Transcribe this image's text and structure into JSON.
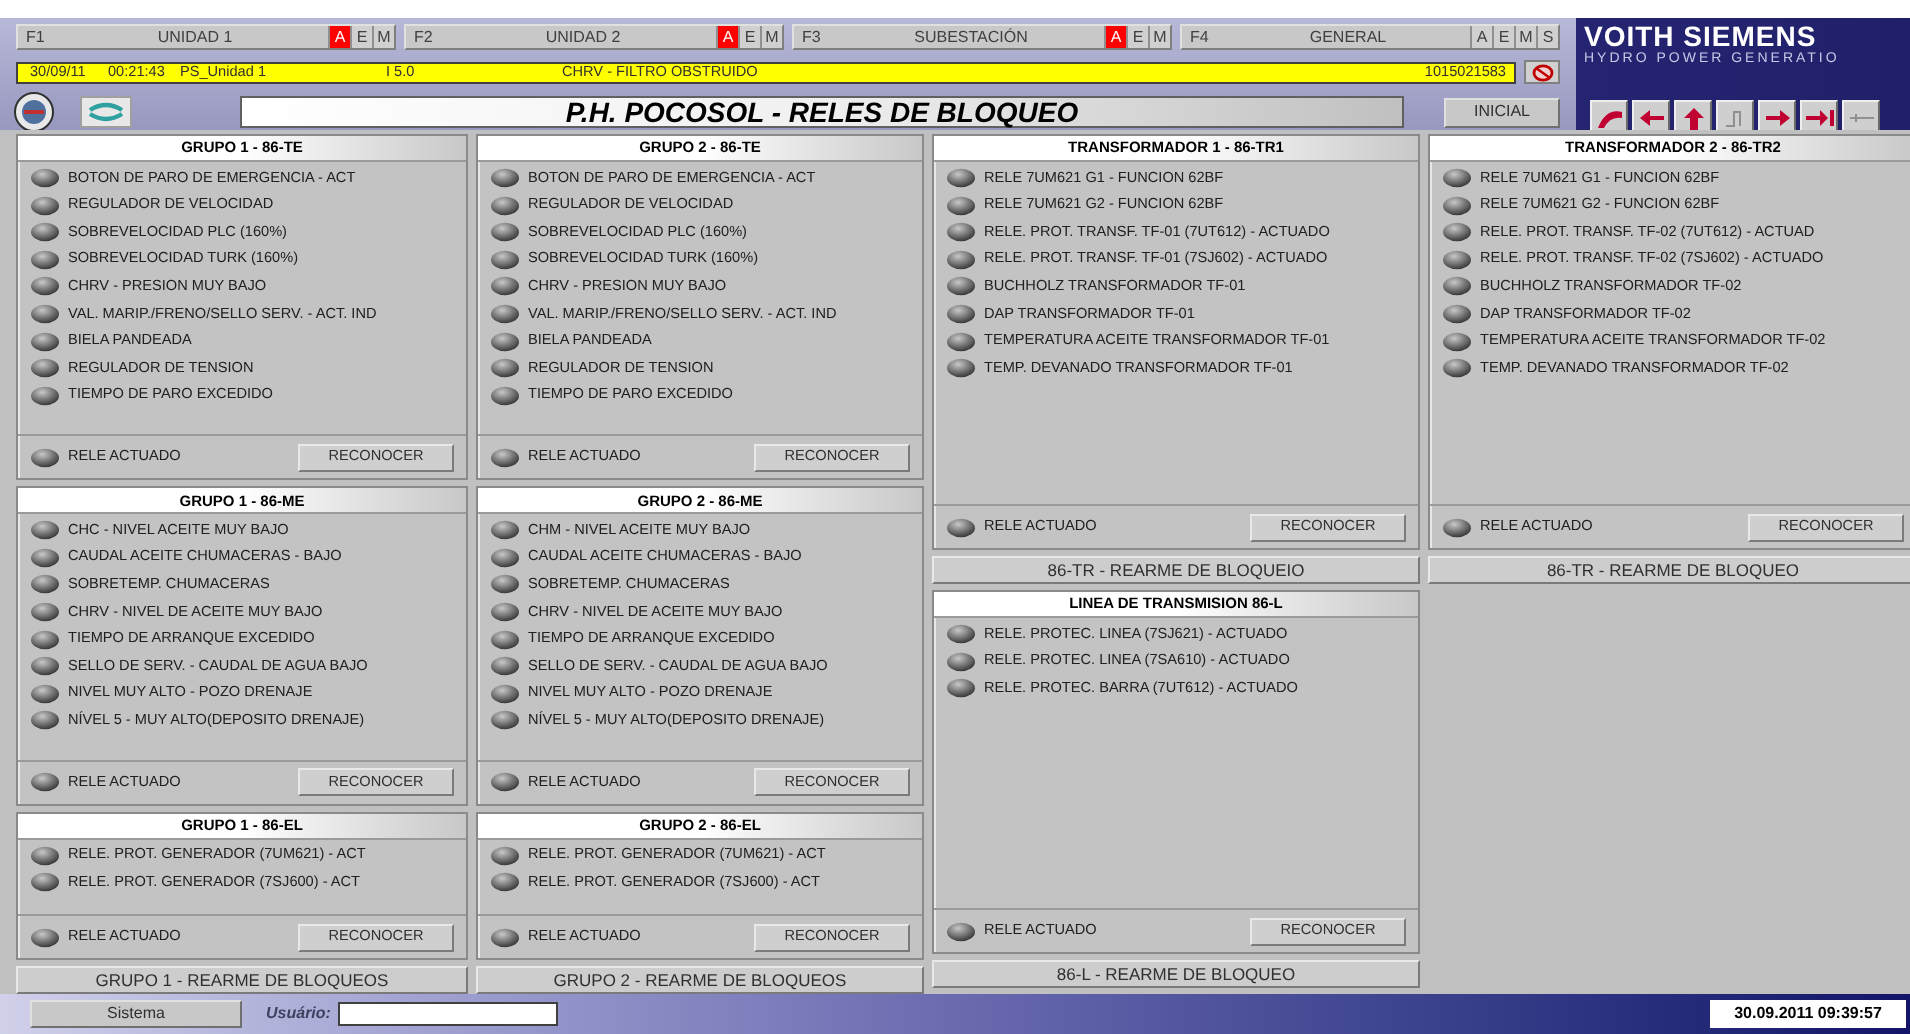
{
  "tabs": [
    {
      "key": "F1",
      "label": "UNIDAD 1",
      "flags": [
        {
          "letter": "A",
          "active": true
        },
        {
          "letter": "E",
          "active": false
        },
        {
          "letter": "M",
          "active": false
        }
      ]
    },
    {
      "key": "F2",
      "label": "UNIDAD 2",
      "flags": [
        {
          "letter": "A",
          "active": true
        },
        {
          "letter": "E",
          "active": false
        },
        {
          "letter": "M",
          "active": false
        }
      ]
    },
    {
      "key": "F3",
      "label": "SUBESTACIÓN",
      "flags": [
        {
          "letter": "A",
          "active": true
        },
        {
          "letter": "E",
          "active": false
        },
        {
          "letter": "M",
          "active": false
        }
      ]
    },
    {
      "key": "F4",
      "label": "GENERAL",
      "flags": [
        {
          "letter": "A",
          "active": false
        },
        {
          "letter": "E",
          "active": false
        },
        {
          "letter": "M",
          "active": false
        },
        {
          "letter": "S",
          "active": false
        }
      ]
    }
  ],
  "brand": {
    "name": "VOITH SIEMENS",
    "tagline": "HYDRO POWER GENERATIO"
  },
  "alarm_bar": {
    "date": "30/09/11",
    "time": "00:21:43",
    "source": "PS_Unidad 1",
    "code": "I 5.0",
    "message": "CHRV - FILTRO OBSTRUIDO",
    "counter": "1015021583"
  },
  "title": "P.H. POCOSOL - RELES DE BLOQUEO",
  "home_button": "INICIAL",
  "columns": [
    [
      {
        "kind": "panel",
        "title": "GRUPO 1 - 86-TE",
        "items": [
          {
            "label": "BOTON DE PARO DE EMERGENCIA - ACT",
            "active": false
          },
          {
            "label": "REGULADOR DE VELOCIDAD",
            "active": false
          },
          {
            "label": "SOBREVELOCIDAD  PLC (160%)",
            "active": false
          },
          {
            "label": "SOBREVELOCIDAD  TURK (160%)",
            "active": false
          },
          {
            "label": "CHRV -  PRESION MUY BAJO",
            "active": false
          },
          {
            "label": "VAL. MARIP./FRENO/SELLO SERV. - ACT. IND",
            "active": false
          },
          {
            "label": "BIELA PANDEADA",
            "active": false
          },
          {
            "label": "REGULADOR DE TENSION",
            "active": false
          },
          {
            "label": "TIEMPO DE PARO EXCEDIDO",
            "active": false
          }
        ],
        "footer": {
          "label": "RELE ACTUADO",
          "active": false,
          "button": "RECONOCER"
        }
      },
      {
        "kind": "panel",
        "title": "GRUPO 1 - 86-ME",
        "items": [
          {
            "label": "CHC - NIVEL ACEITE MUY BAJO",
            "active": false
          },
          {
            "label": "CAUDAL ACEITE CHUMACERAS - BAJO",
            "active": false
          },
          {
            "label": "SOBRETEMP. CHUMACERAS",
            "active": false
          },
          {
            "label": "CHRV - NIVEL DE ACEITE MUY BAJO",
            "active": false
          },
          {
            "label": "TIEMPO DE ARRANQUE EXCEDIDO",
            "active": false
          },
          {
            "label": "SELLO DE SERV. - CAUDAL DE AGUA BAJO",
            "active": false
          },
          {
            "label": "NIVEL MUY ALTO - POZO DRENAJE",
            "active": false
          },
          {
            "label": "NÍVEL 5 - MUY ALTO(DEPOSITO DRENAJE)",
            "active": false
          }
        ],
        "footer": {
          "label": "RELE ACTUADO",
          "active": false,
          "button": "RECONOCER"
        }
      },
      {
        "kind": "panel",
        "title": "GRUPO 1 - 86-EL",
        "items": [
          {
            "label": "RELE. PROT. GENERADOR (7UM621) - ACT",
            "active": false
          },
          {
            "label": "RELE. PROT. GENERADOR (7SJ600) - ACT",
            "active": false
          }
        ],
        "footer": {
          "label": "RELE ACTUADO",
          "active": false,
          "button": "RECONOCER"
        }
      },
      {
        "kind": "reset",
        "label": "GRUPO 1 - REARME DE BLOQUEOS"
      }
    ],
    [
      {
        "kind": "panel",
        "title": "GRUPO 2 - 86-TE",
        "items": [
          {
            "label": "BOTON DE PARO DE EMERGENCIA - ACT",
            "active": false
          },
          {
            "label": "REGULADOR DE VELOCIDAD",
            "active": false
          },
          {
            "label": "SOBREVELOCIDAD  PLC (160%)",
            "active": false
          },
          {
            "label": "SOBREVELOCIDAD  TURK (160%)",
            "active": false
          },
          {
            "label": "CHRV -  PRESION MUY BAJO",
            "active": false
          },
          {
            "label": "VAL. MARIP./FRENO/SELLO SERV. - ACT. IND",
            "active": false
          },
          {
            "label": "BIELA PANDEADA",
            "active": false
          },
          {
            "label": "REGULADOR DE TENSION",
            "active": false
          },
          {
            "label": "TIEMPO DE PARO EXCEDIDO",
            "active": false
          }
        ],
        "footer": {
          "label": "RELE ACTUADO",
          "active": false,
          "button": "RECONOCER"
        }
      },
      {
        "kind": "panel",
        "title": "GRUPO 2 - 86-ME",
        "items": [
          {
            "label": "CHM - NIVEL ACEITE MUY BAJO",
            "active": false
          },
          {
            "label": "CAUDAL ACEITE CHUMACERAS - BAJO",
            "active": false
          },
          {
            "label": "SOBRETEMP. CHUMACERAS",
            "active": false
          },
          {
            "label": "CHRV - NIVEL DE ACEITE MUY BAJO",
            "active": false
          },
          {
            "label": "TIEMPO DE ARRANQUE EXCEDIDO",
            "active": false
          },
          {
            "label": "SELLO DE SERV. - CAUDAL DE AGUA BAJO",
            "active": false
          },
          {
            "label": "NIVEL MUY ALTO - POZO DRENAJE",
            "active": false
          },
          {
            "label": "NÍVEL 5 - MUY ALTO(DEPOSITO DRENAJE)",
            "active": false
          }
        ],
        "footer": {
          "label": "RELE ACTUADO",
          "active": false,
          "button": "RECONOCER"
        }
      },
      {
        "kind": "panel",
        "title": "GRUPO 2 - 86-EL",
        "items": [
          {
            "label": "RELE. PROT. GENERADOR (7UM621) - ACT",
            "active": false
          },
          {
            "label": "RELE. PROT. GENERADOR (7SJ600) - ACT",
            "active": false
          }
        ],
        "footer": {
          "label": "RELE ACTUADO",
          "active": false,
          "button": "RECONOCER"
        }
      },
      {
        "kind": "reset",
        "label": "GRUPO 2 - REARME DE BLOQUEOS"
      }
    ],
    [
      {
        "kind": "panel",
        "title": "TRANSFORMADOR 1 - 86-TR1",
        "items": [
          {
            "label": "RELE 7UM621 G1 - FUNCION 62BF",
            "active": false
          },
          {
            "label": "RELE 7UM621 G2 - FUNCION 62BF",
            "active": false
          },
          {
            "label": "RELE. PROT. TRANSF. TF-01 (7UT612) - ACTUADO",
            "active": false
          },
          {
            "label": "RELE. PROT. TRANSF. TF-01 (7SJ602) - ACTUADO",
            "active": false
          },
          {
            "label": "BUCHHOLZ TRANSFORMADOR TF-01",
            "active": false
          },
          {
            "label": "DAP TRANSFORMADOR TF-01",
            "active": false
          },
          {
            "label": "TEMPERATURA ACEITE TRANSFORMADOR TF-01",
            "active": false
          },
          {
            "label": "TEMP. DEVANADO TRANSFORMADOR TF-01",
            "active": false
          }
        ],
        "footer": {
          "label": "RELE ACTUADO",
          "active": false,
          "button": "RECONOCER"
        }
      },
      {
        "kind": "reset",
        "label": "86-TR - REARME DE BLOQUEIO"
      },
      {
        "kind": "panel",
        "title": "LINEA DE TRANSMISION 86-L",
        "items": [
          {
            "label": "RELE. PROTEC. LINEA (7SJ621) - ACTUADO",
            "active": false
          },
          {
            "label": "RELE. PROTEC. LINEA (7SA610) - ACTUADO",
            "active": false
          },
          {
            "label": "RELE. PROTEC. BARRA (7UT612) - ACTUADO",
            "active": false
          }
        ],
        "footer": {
          "label": "RELE ACTUADO",
          "active": false,
          "button": "RECONOCER"
        }
      },
      {
        "kind": "reset",
        "label": "86-L - REARME DE BLOQUEO"
      }
    ],
    [
      {
        "kind": "panel",
        "title": "TRANSFORMADOR 2 - 86-TR2",
        "items": [
          {
            "label": "RELE 7UM621 G1 - FUNCION 62BF",
            "active": false
          },
          {
            "label": "RELE 7UM621 G2 - FUNCION 62BF",
            "active": false
          },
          {
            "label": "RELE. PROT. TRANSF. TF-02 (7UT612) - ACTUAD",
            "active": false
          },
          {
            "label": "RELE. PROT. TRANSF. TF-02 (7SJ602) - ACTUADO",
            "active": false
          },
          {
            "label": "BUCHHOLZ TRANSFORMADOR TF-02",
            "active": false
          },
          {
            "label": "DAP TRANSFORMADOR TF-02",
            "active": false
          },
          {
            "label": "TEMPERATURA ACEITE TRANSFORMADOR TF-02",
            "active": false
          },
          {
            "label": "TEMP. DEVANADO TRANSFORMADOR TF-02",
            "active": false
          }
        ],
        "footer": {
          "label": "RELE ACTUADO",
          "active": false,
          "button": "RECONOCER"
        }
      },
      {
        "kind": "reset",
        "label": "86-TR - REARME DE BLOQUEO"
      }
    ]
  ],
  "status_bar": {
    "system_button": "Sistema",
    "user_label": "Usuário:",
    "datetime": "30.09.2011 09:39:57"
  }
}
